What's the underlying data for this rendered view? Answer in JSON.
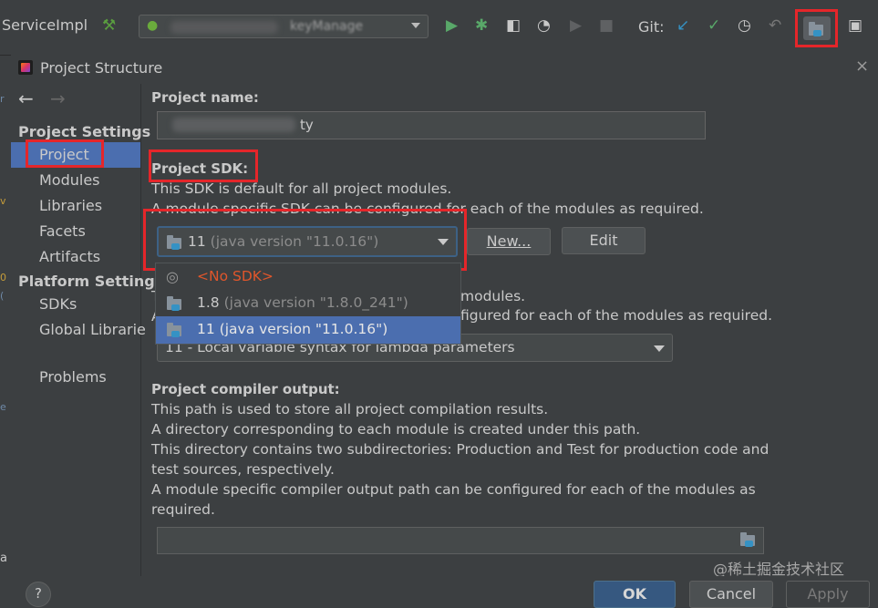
{
  "toolbar": {
    "title": "ServiceImpl",
    "run_config_text": "keyManage",
    "git_label": "Git:"
  },
  "dialog": {
    "title": "Project Structure",
    "close_icon": "×"
  },
  "sidebar": {
    "sections": [
      {
        "label": "Project Settings",
        "items": [
          "Project",
          "Modules",
          "Libraries",
          "Facets",
          "Artifacts"
        ]
      },
      {
        "label": "Platform Setting",
        "items": [
          "SDKs",
          "Global Librarie"
        ]
      }
    ],
    "problems": "Problems",
    "selected": "Project"
  },
  "project": {
    "name_label": "Project name:",
    "name_value": "ty",
    "sdk_label": "Project SDK:",
    "sdk_desc_1": "This SDK is default for all project modules.",
    "sdk_desc_2": "A module specific SDK can be configured for each of the modules as required.",
    "sdk_value": "11",
    "sdk_value_detail": "(java version \"11.0.16\")",
    "new_button": "New...",
    "edit_button": "Edit",
    "sdk_options": [
      {
        "label": "<No SDK>",
        "detail": ""
      },
      {
        "label": "1.8",
        "detail": "(java version \"1.8.0_241\")"
      },
      {
        "label": "11",
        "detail": "(java version \"11.0.16\")"
      }
    ],
    "lang_desc_1_tail": "modules.",
    "lang_desc_2_tail": "figured for each of the modules as required.",
    "lang_value": "11 - Local variable syntax for lambda parameters",
    "output_label": "Project compiler output:",
    "output_desc": [
      "This path is used to store all project compilation results.",
      "A directory corresponding to each module is created under this path.",
      "This directory contains two subdirectories: Production and Test for production code and",
      "test sources, respectively.",
      "A module specific compiler output path can be configured for each of the modules as",
      "required."
    ]
  },
  "footer": {
    "help": "?",
    "ok": "OK",
    "cancel": "Cancel",
    "apply": "Apply"
  },
  "watermark": "@稀土掘金技术社区",
  "colors": {
    "selection": "#4b6eaf",
    "highlight_box": "#e5262a",
    "no_sdk": "#e0562b"
  }
}
